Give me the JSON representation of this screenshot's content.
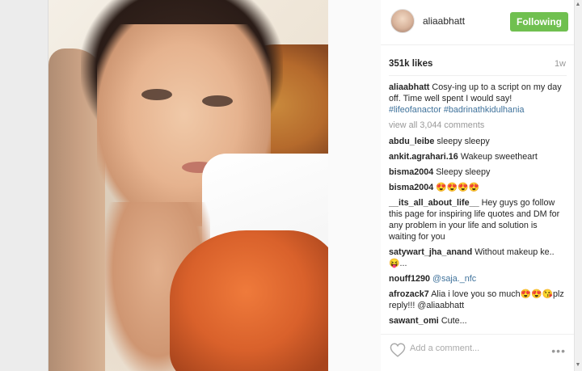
{
  "post": {
    "username": "aliaabhatt",
    "follow_label": "Following",
    "likes": "351k likes",
    "time_ago": "1w",
    "caption_user": "aliaabhatt",
    "caption_text": "Cosy-ing up to a script on my day off. Time well spent I would say! ",
    "caption_hashtags": "#lifeofanactor #badrinathkidulhania",
    "view_all": "view all 3,044 comments",
    "comments": [
      {
        "user": "abdu_leibe",
        "text": "sleepy sleepy"
      },
      {
        "user": "ankit.agrahari.16",
        "text": "Wakeup sweetheart"
      },
      {
        "user": "bisma2004",
        "text": "Sleepy sleepy"
      },
      {
        "user": "bisma2004",
        "text": "😍😍😍😍"
      },
      {
        "user": "__its_all_about_life__",
        "text": "Hey guys go follow this page for inspiring life quotes and DM for any problem in your life and solution is waiting for you"
      },
      {
        "user": "satywart_jha_anand",
        "text": "Without makeup ke..😝..."
      },
      {
        "user": "nouff1290",
        "text": "@saja._nfc"
      },
      {
        "user": "afrozack7",
        "text": "Alia i love you so much😍😍😘plz reply!!! @aliaabhatt"
      },
      {
        "user": "sawant_omi",
        "text": "Cute..."
      }
    ],
    "add_comment_placeholder": "Add a comment...",
    "more_label": "•••"
  },
  "icons": {
    "heart": "heart-icon",
    "more": "more-options-icon",
    "avatar": "avatar"
  },
  "colors": {
    "follow_green": "#70c050",
    "link_blue": "#3f729b"
  }
}
